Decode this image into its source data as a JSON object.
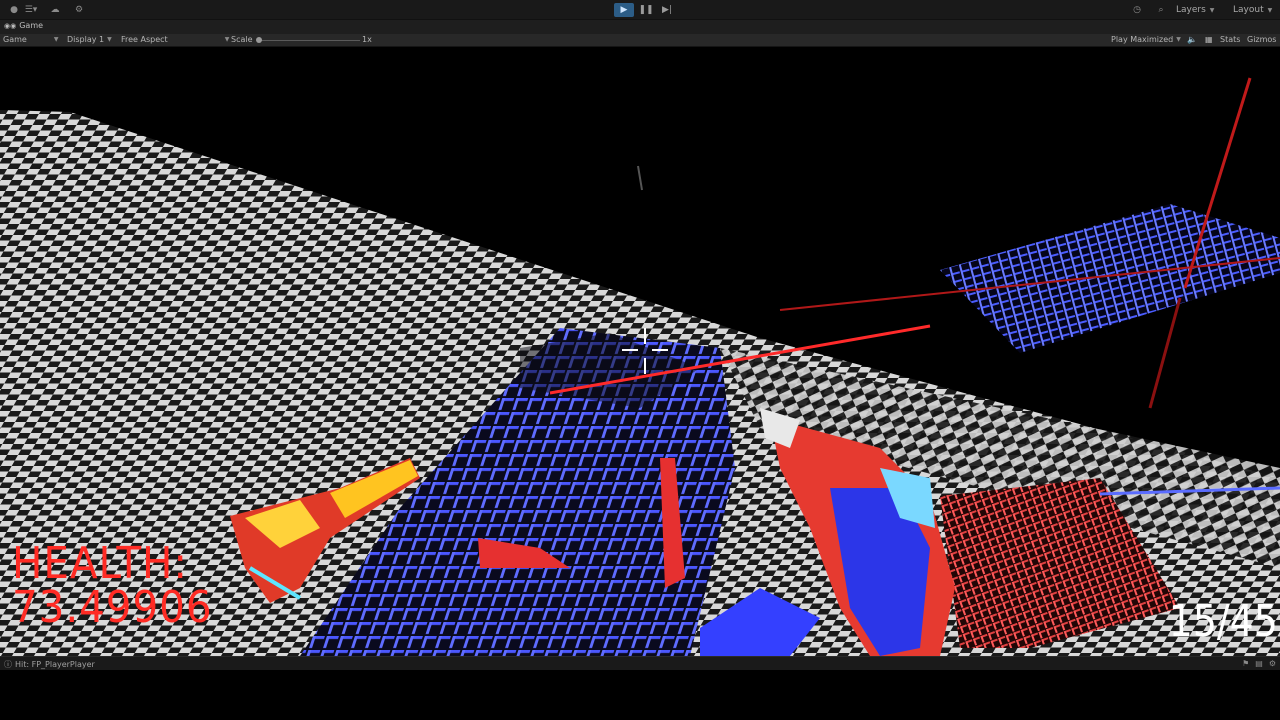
{
  "toolbar": {
    "left_icons": [
      "account-icon",
      "layers-menu-icon",
      "cloud-icon",
      "settings-icon"
    ],
    "play_icon": "▶",
    "pause_icon": "❚❚",
    "step_icon": "▶|",
    "history_icon": "history-icon",
    "search_icon": "search-icon",
    "layers_label": "Layers",
    "layout_label": "Layout",
    "accent_color": "#2c5d87"
  },
  "tab": {
    "label": "Game"
  },
  "gamebar": {
    "mode": "Game",
    "display": "Display 1",
    "aspect": "Free Aspect",
    "scale_label": "Scale",
    "scale_value": "1x",
    "play_mode": "Play Maximized",
    "stats_label": "Stats",
    "gizmos_label": "Gizmos"
  },
  "hud": {
    "health_label": "HEALTH:",
    "health_value": "73.49906",
    "ammo": "15/45",
    "health_color": "#ff2b24"
  },
  "status": {
    "message": "Hit: FP_PlayerPlayer"
  }
}
